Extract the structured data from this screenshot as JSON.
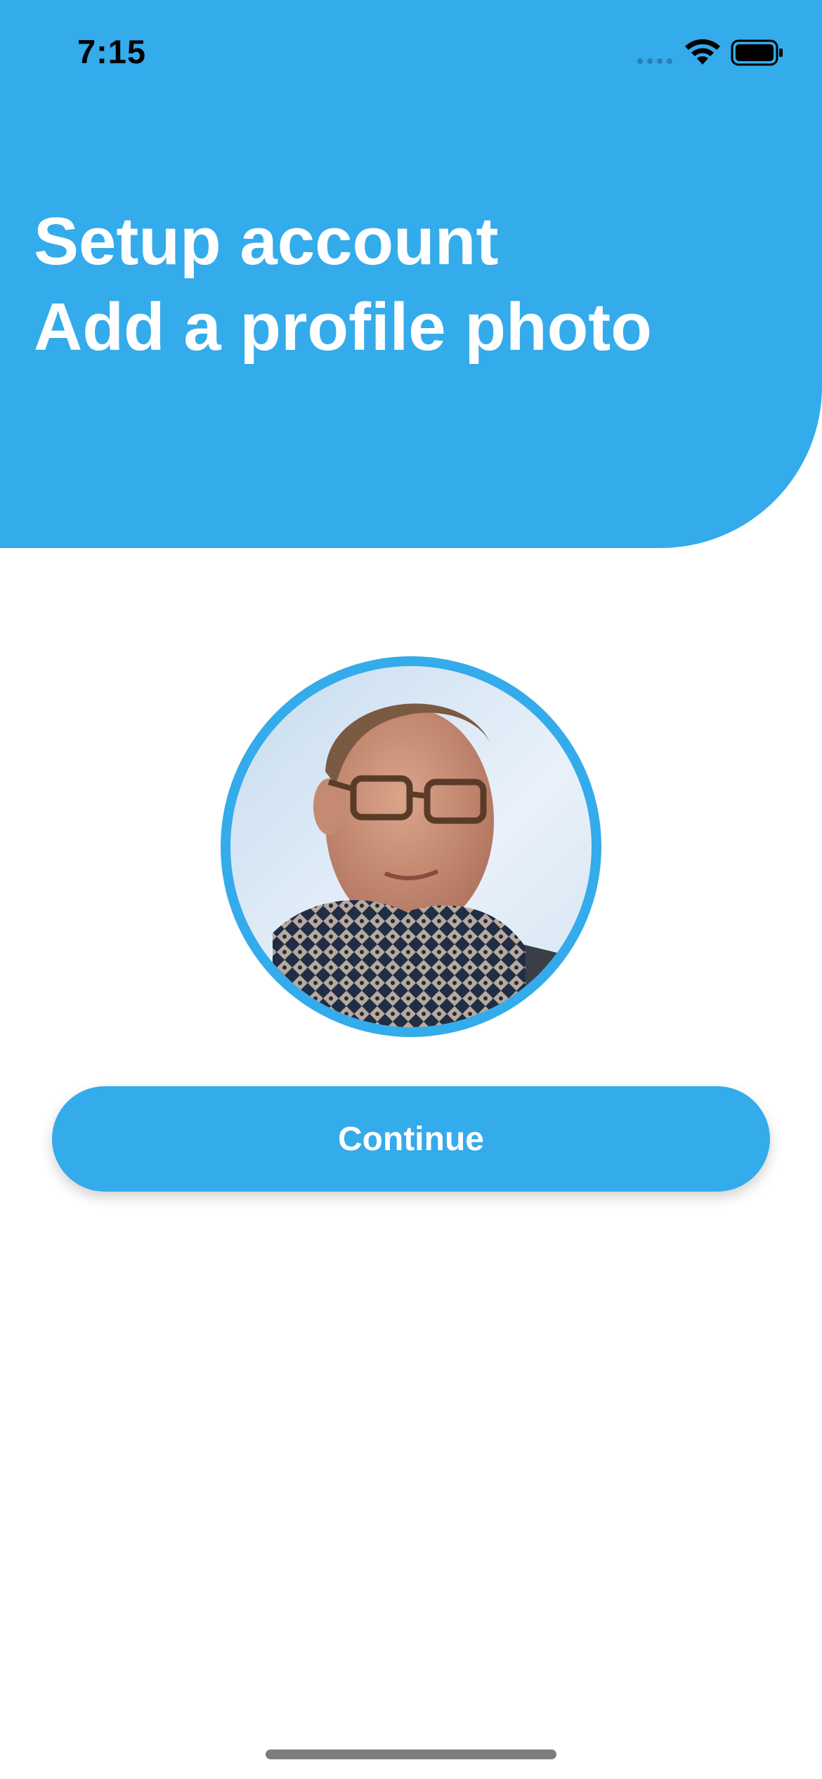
{
  "status_bar": {
    "time": "7:15",
    "icons": [
      "signal-icon",
      "wifi-icon",
      "battery-icon"
    ]
  },
  "header": {
    "title_line1": "Setup account",
    "title_line2": "Add a profile photo"
  },
  "profile": {
    "avatar": "profile-photo"
  },
  "actions": {
    "continue_label": "Continue"
  },
  "colors": {
    "accent": "#34ABEB",
    "background": "#FFFFFF",
    "text_on_accent": "#FFFFFF"
  }
}
